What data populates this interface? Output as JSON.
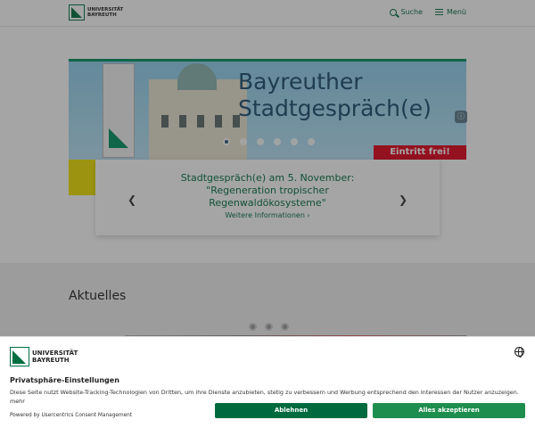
{
  "header": {
    "logo_line1": "UNIVERSITÄT",
    "logo_line2": "BAYREUTH",
    "search_label": "Suche",
    "menu_label": "Menü"
  },
  "hero": {
    "title_line1": "Bayreuther",
    "title_line2": "Stadtgespräch(e)",
    "badge": "Eintritt frei!",
    "slide_count": 6,
    "active_slide": 1,
    "caption_title": "Stadtgespräch(e) am 5. November: \"Regeneration tropischer Regenwaldökosysteme\"",
    "caption_link": "Weitere Informationen ›",
    "prev_icon": "chevron-left-icon",
    "next_icon": "chevron-right-icon"
  },
  "news": {
    "heading": "Aktuelles",
    "dot_count": 3
  },
  "consent": {
    "logo_line1": "UNIVERSITÄT",
    "logo_line2": "BAYREUTH",
    "title": "Privatsphäre-Einstellungen",
    "text": "Diese Seite nutzt Website-Tracking-Technologien von Dritten, um ihre Dienste anzubieten, stetig zu verbessern und Werbung entsprechend den Interessen der Nutzer anzuzeigen.",
    "more": "mehr",
    "powered": "Powered by Usercentrics Consent Management",
    "deny_label": "Ablehnen",
    "accept_label": "Alles akzeptieren",
    "language_icon": "globe-icon"
  },
  "colors": {
    "brand_green": "#006e40",
    "accept_green": "#1e8e4f",
    "badge_red": "#e2001a",
    "yellow": "#f0e100"
  }
}
